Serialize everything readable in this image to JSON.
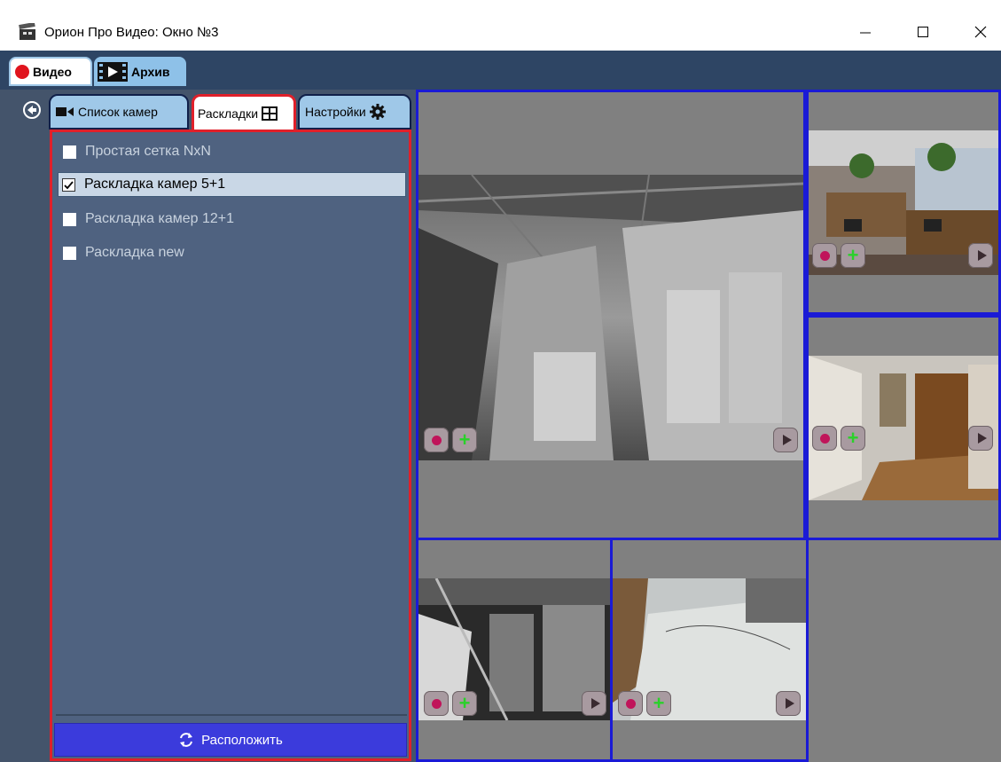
{
  "window": {
    "title": "Орион Про Видео: Окно №3",
    "minimize": "—",
    "maximize": "☐",
    "close": "✕"
  },
  "top_tabs": [
    {
      "label": "Видео",
      "icon": "record-icon",
      "active": true
    },
    {
      "label": "Архив",
      "icon": "film-icon",
      "active": false
    }
  ],
  "sub_tabs": [
    {
      "label": "Список камер",
      "icon": "camera-icon"
    },
    {
      "label": "Раскладки",
      "icon": "grid-icon"
    },
    {
      "label": "Настройки",
      "icon": "gear-icon"
    }
  ],
  "layouts": [
    {
      "label": "Простая сетка NxN",
      "checked": false
    },
    {
      "label": "Раскладка камер 5+1",
      "checked": true
    },
    {
      "label": "Раскладка камер 12+1",
      "checked": false
    },
    {
      "label": "Раскладка new",
      "checked": false
    }
  ],
  "arrange_button": {
    "label": "Расположить",
    "icon": "refresh-icon"
  },
  "colors": {
    "accent_red": "#e0202a",
    "grid_border_blue": "#1a1ad6",
    "button_blue": "#3b3bdc",
    "panel_bg": "#4f6280"
  }
}
